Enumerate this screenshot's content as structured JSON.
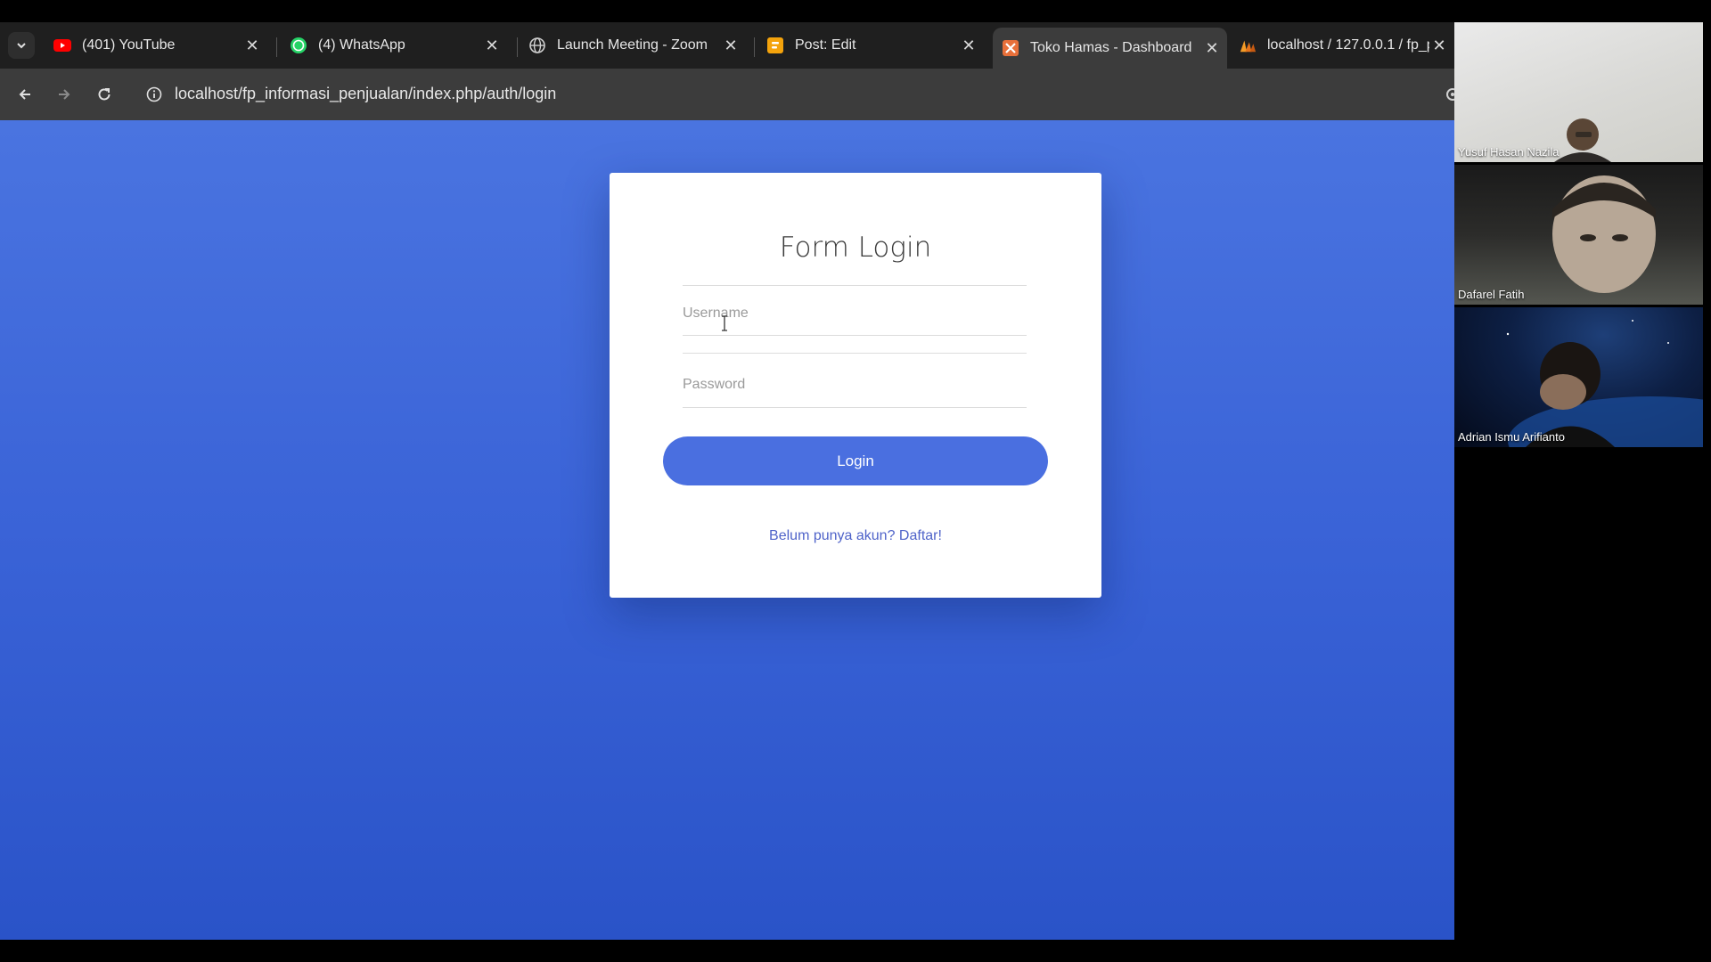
{
  "browser": {
    "tabs": [
      {
        "title": "(401) YouTube",
        "icon": "youtube-icon",
        "active": false
      },
      {
        "title": "(4) WhatsApp",
        "icon": "whatsapp-icon",
        "active": false
      },
      {
        "title": "Launch Meeting - Zoom",
        "icon": "globe-icon",
        "active": false
      },
      {
        "title": "Post: Edit",
        "icon": "blogger-icon",
        "active": false
      },
      {
        "title": "Toko Hamas - Dashboard",
        "icon": "site-logo-icon",
        "active": true
      },
      {
        "title": "localhost / 127.0.0.1 / fp_p",
        "icon": "phpmyadmin-icon",
        "active": false
      }
    ],
    "url": "localhost/fp_informasi_penjualan/index.php/auth/login",
    "colors": {
      "tab_strip": "#1f1f1f",
      "toolbar": "#3c3c3c"
    }
  },
  "login": {
    "title": "Form Login",
    "username_placeholder": "Username",
    "username_value": "",
    "password_placeholder": "Password",
    "password_value": "",
    "button_label": "Login",
    "register_link": "Belum punya akun? Daftar!",
    "colors": {
      "accent": "#4a6fe0",
      "link": "#4f63c9"
    }
  },
  "meeting": {
    "participants": [
      {
        "name": "Yusuf Hasan Nazila"
      },
      {
        "name": "Dafarel Fatih"
      },
      {
        "name": "Adrian Ismu Arifianto"
      }
    ]
  }
}
